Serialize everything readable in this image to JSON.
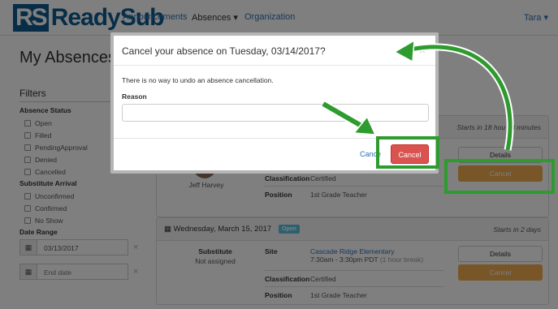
{
  "nav": {
    "logo_rs": "RS",
    "logo_text": "ReadySub",
    "links": [
      "Announcements",
      "Absences",
      "Organization"
    ],
    "user": "Tara"
  },
  "page_title": "My Absences",
  "filters": {
    "title": "Filters",
    "absence_status_label": "Absence Status",
    "absence_status": [
      "Open",
      "Filled",
      "PendingApproval",
      "Denied",
      "Cancelled"
    ],
    "substitute_arrival_label": "Substitute Arrival",
    "substitute_arrival": [
      "Unconfirmed",
      "Confirmed",
      "No Show"
    ],
    "date_range_label": "Date Range",
    "start_date": "03/13/2017",
    "end_date_placeholder": "End date"
  },
  "absences": [
    {
      "date": "",
      "starts": "Starts in 18 hours 38 minutes",
      "starts_visible": "Starts in 18 hou   38 minutes",
      "substitute_name": "Jeff Harvey",
      "classification": "Certified",
      "position": "1st Grade Teacher",
      "details_label": "Details",
      "cancel_label": "Cancel"
    },
    {
      "date": "Wednesday, March 15, 2017",
      "status": "Open",
      "starts": "Starts in 2 days",
      "substitute_label": "Substitute",
      "substitute_name": "Not assigned",
      "site_label": "Site",
      "site": "Cascade Ridge Elementary",
      "time": "7:30am - 3:30pm PDT",
      "break": "(1 hour break)",
      "classification_label": "Classification",
      "classification": "Certified",
      "position_label": "Position",
      "position": "1st Grade Teacher",
      "details_label": "Details",
      "cancel_label": "Cancel"
    }
  ],
  "modal": {
    "title": "Cancel your absence on Tuesday, 03/14/2017?",
    "close": "×",
    "message": "There is no way to undo an absence cancellation.",
    "reason_label": "Reason",
    "reason_value": "",
    "cancel_link": "Cance",
    "confirm_button": "Cancel"
  },
  "colors": {
    "brand": "#0f5a8f",
    "link": "#2d6fb0",
    "danger": "#d9534f",
    "warning": "#f0ad4e",
    "highlight": "#2e9b2e"
  }
}
